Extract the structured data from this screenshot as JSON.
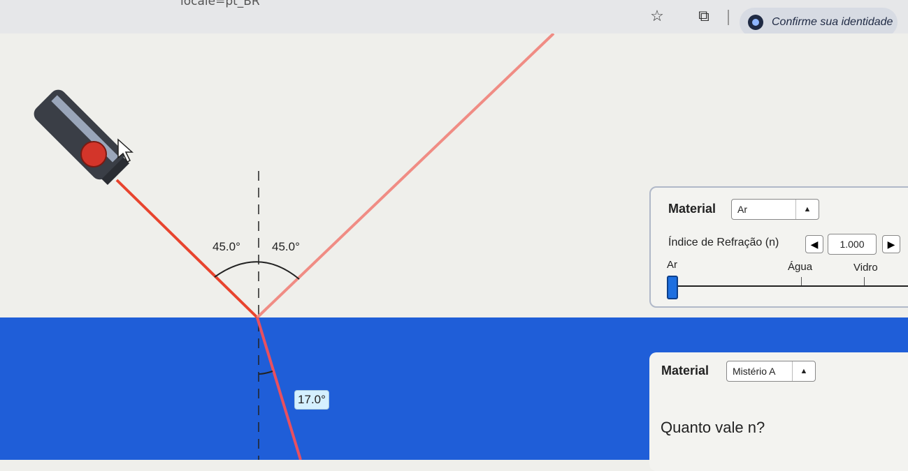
{
  "browser": {
    "url_fragment": "locale=pt_BR",
    "identity_label": "Confirme sua identidade"
  },
  "colors": {
    "upper_medium": "#efefeb",
    "lower_medium": "#1f5ed8",
    "incident_ray": "#e8442e",
    "reflected_ray": "#f08c84",
    "refracted_ray": "#e85060"
  },
  "scene": {
    "upper_incidence_angle_label": "45.0°",
    "upper_reflection_angle_label": "45.0°",
    "refracted_angle_label": "17.0°"
  },
  "top_panel": {
    "material_label": "Material",
    "material_value": "Ar",
    "index_label": "Índice de Refração (n)",
    "index_value": "1.000",
    "slider_labels": [
      "Ar",
      "Água",
      "Vidro"
    ],
    "slider_value": 1.0
  },
  "bottom_panel": {
    "material_label": "Material",
    "material_value": "Mistério A",
    "question": "Quanto vale n?"
  }
}
